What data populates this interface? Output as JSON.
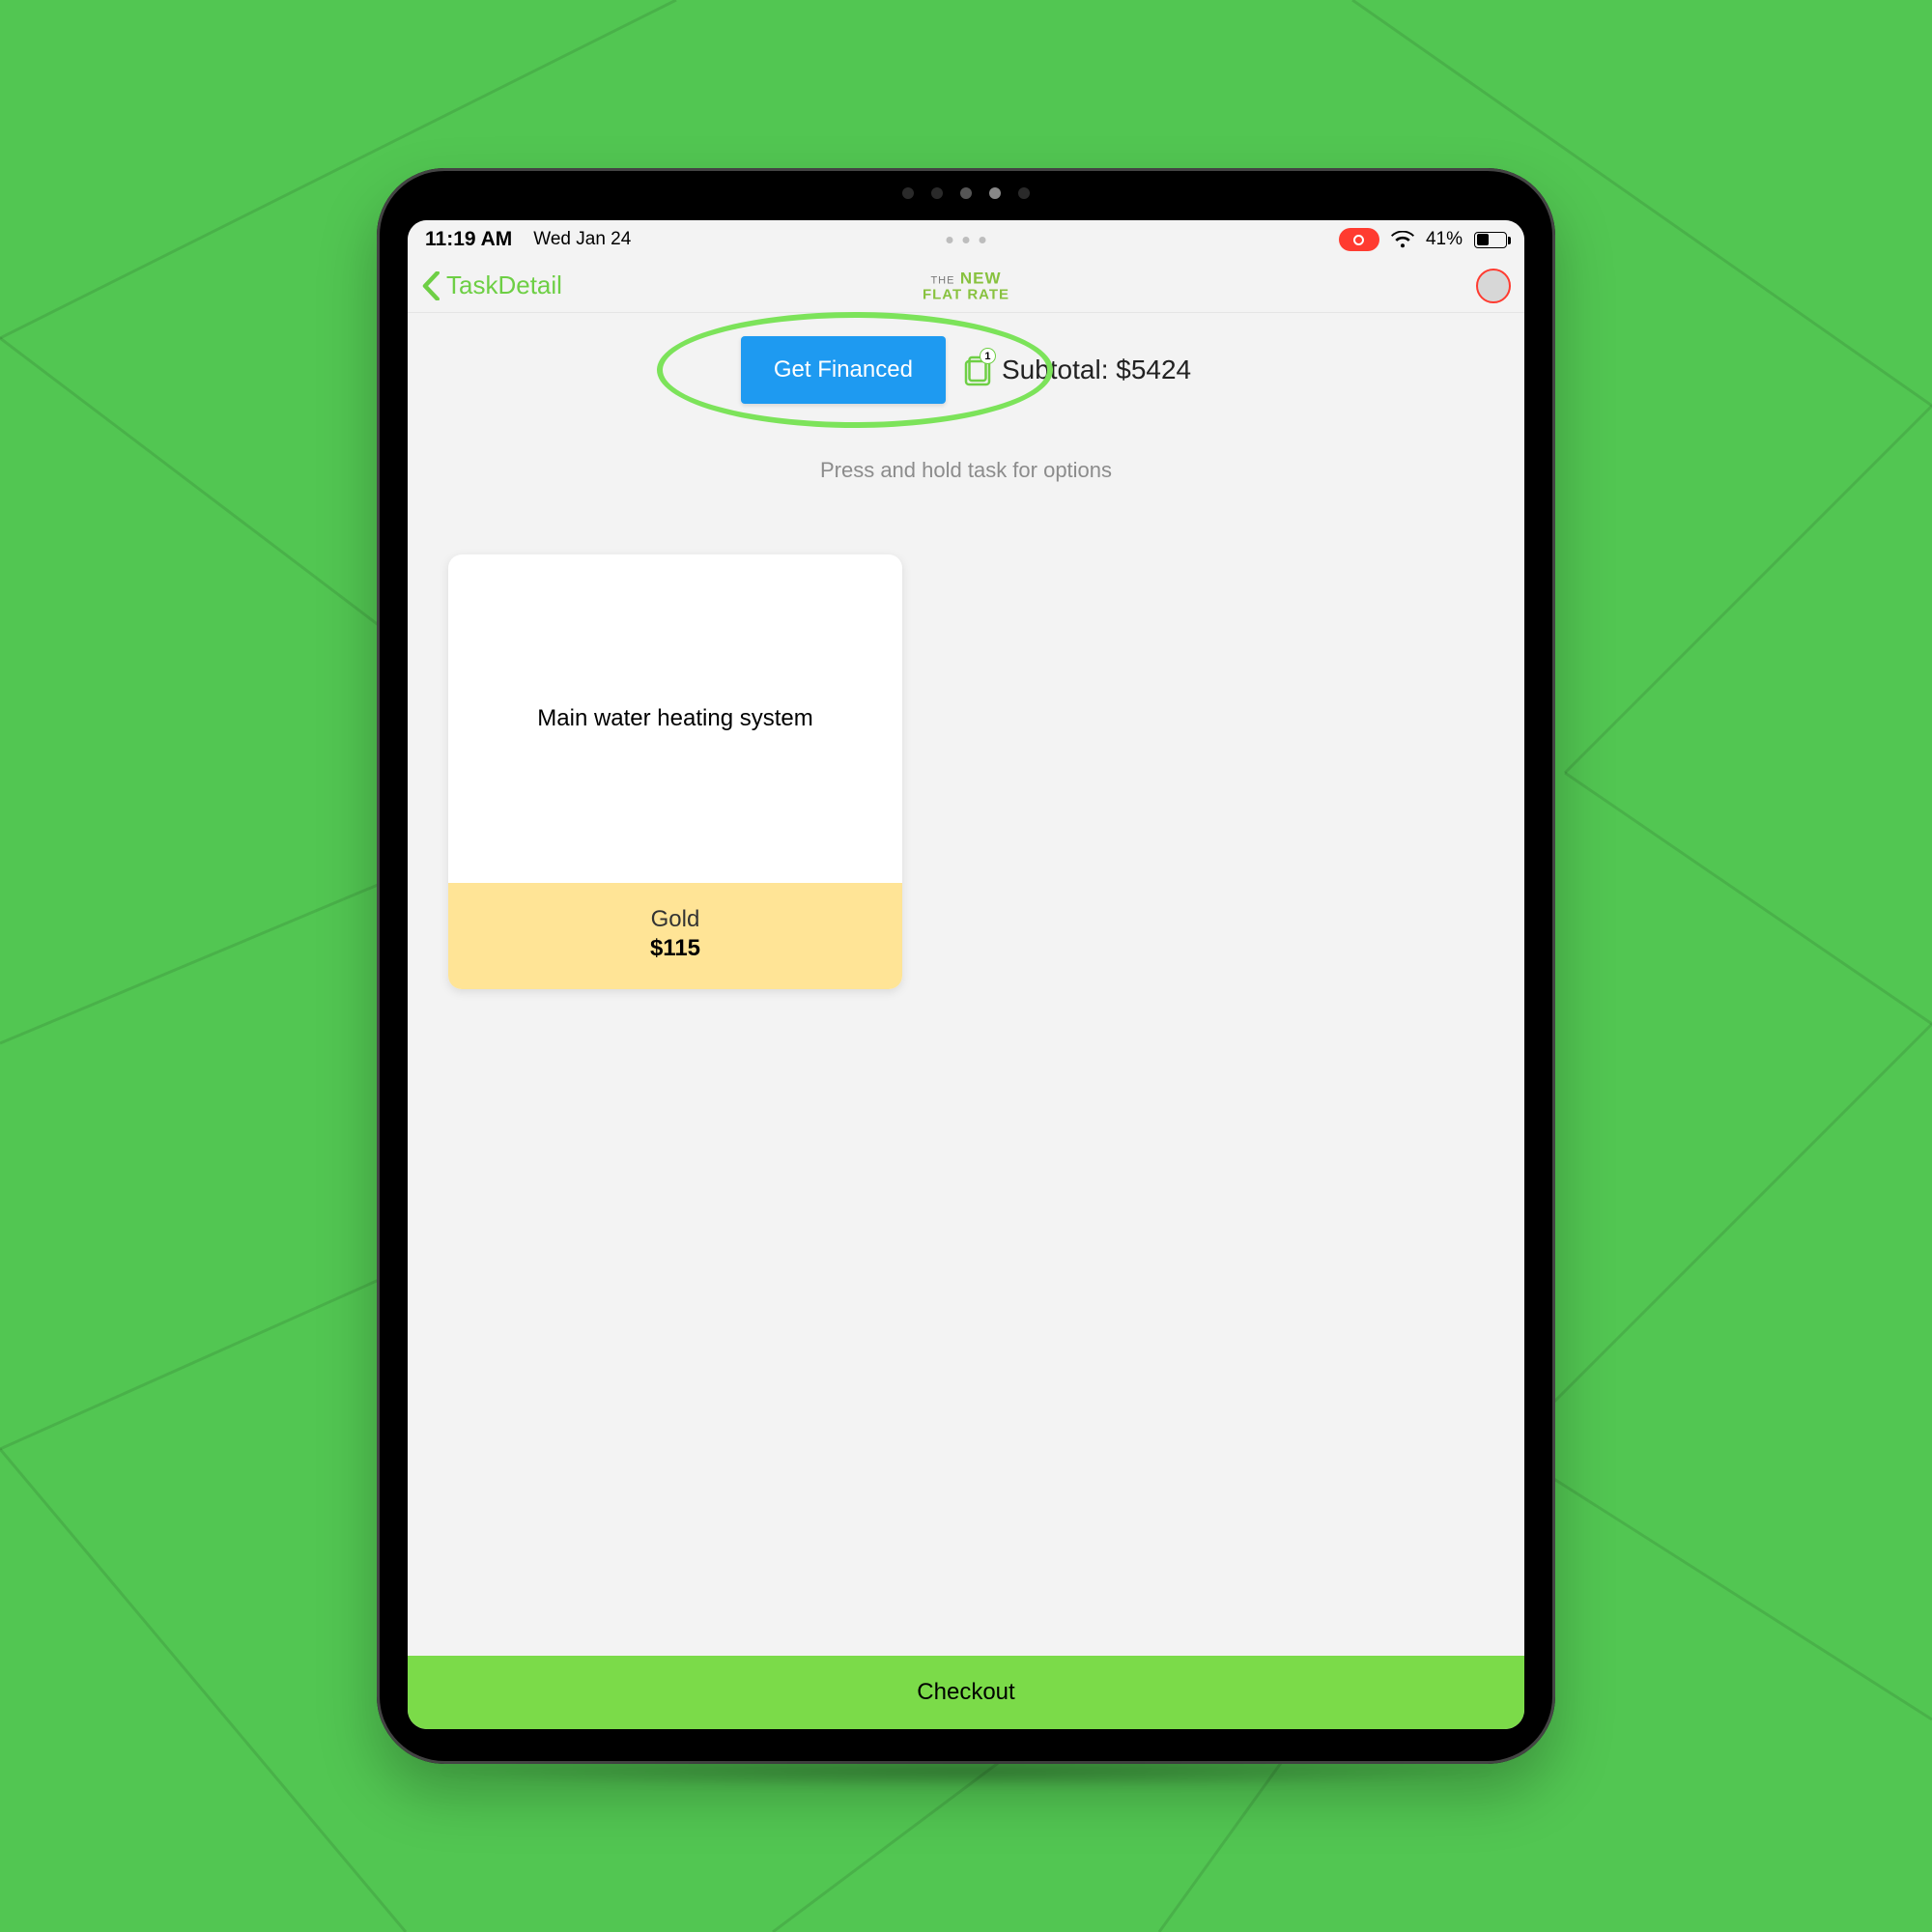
{
  "status": {
    "time": "11:19 AM",
    "date": "Wed Jan 24",
    "battery_pct": "41%",
    "wifi_icon": "wifi-icon",
    "recording": true
  },
  "nav": {
    "back_label": "TaskDetail",
    "logo_line1": "THE",
    "logo_line2": "NEW",
    "logo_line3": "FLAT RATE"
  },
  "actions": {
    "finance_label": "Get Financed",
    "cart_badge": "1",
    "subtotal_label": "Subtotal: $5424",
    "hint": "Press and hold task for options"
  },
  "task": {
    "title": "Main water heating system",
    "tier": "Gold",
    "price": "$115"
  },
  "checkout_label": "Checkout",
  "colors": {
    "accent_green": "#52C652",
    "primary_blue": "#1E9AF1",
    "gold_bg": "#FFE496",
    "checkout_green": "#7BDB49",
    "highlight": "#7CE35A"
  }
}
